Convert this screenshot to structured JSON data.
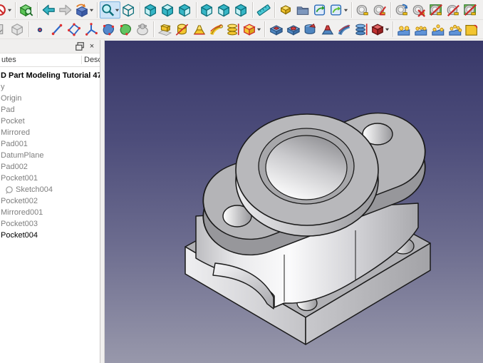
{
  "toolbars": {
    "row1": [
      {
        "icon": "draw-style",
        "name": "draw-style",
        "dropdown": true,
        "cut": true
      },
      {
        "sep": true
      },
      {
        "icon": "fit-all",
        "name": "view-fit-all"
      },
      {
        "sep": true
      },
      {
        "icon": "nav-back",
        "name": "navigate-back"
      },
      {
        "icon": "nav-forward",
        "name": "navigate-forward",
        "disabled": true
      },
      {
        "icon": "linked-object",
        "name": "go-to-linked-object",
        "dropdown": true
      },
      {
        "sep": true
      },
      {
        "icon": "zoom",
        "name": "zoom-tools",
        "active": true,
        "dropdown": true
      },
      {
        "icon": "cube-axo",
        "name": "view-axonometric"
      },
      {
        "sep": true
      },
      {
        "icon": "cube-front",
        "name": "view-front"
      },
      {
        "icon": "cube-top",
        "name": "view-top"
      },
      {
        "icon": "cube-right",
        "name": "view-right"
      },
      {
        "sep": true
      },
      {
        "icon": "cube-rear",
        "name": "view-rear"
      },
      {
        "icon": "cube-bottom",
        "name": "view-bottom"
      },
      {
        "icon": "cube-left",
        "name": "view-left"
      },
      {
        "sep": true
      },
      {
        "icon": "ruler",
        "name": "measure-distance"
      },
      {
        "sep": true
      },
      {
        "icon": "create-part",
        "name": "create-part"
      },
      {
        "icon": "create-group",
        "name": "create-group"
      },
      {
        "icon": "make-link",
        "name": "make-link"
      },
      {
        "icon": "make-sub-link",
        "name": "make-sub-link",
        "dropdown": true
      },
      {
        "sep": true
      },
      {
        "icon": "measure-linear",
        "name": "measure-linear"
      },
      {
        "icon": "measure-angular",
        "name": "measure-angular"
      },
      {
        "sep": true
      },
      {
        "icon": "measure-refresh",
        "name": "measure-refresh"
      },
      {
        "icon": "measure-clear",
        "name": "measure-clear-all"
      },
      {
        "icon": "measure-toggle-3d",
        "name": "toggle-measurement-3d"
      },
      {
        "icon": "measure-toggle-delta",
        "name": "toggle-measurement-delta"
      },
      {
        "icon": "measure-toggle-3d",
        "name": "toggle-measurement-overflow"
      }
    ],
    "row2": [
      {
        "icon": "cut-gray",
        "name": "toolbar-cut-icon",
        "cut": true
      },
      {
        "icon": "create-body",
        "name": "create-body",
        "disabled": true
      },
      {
        "sep": true
      },
      {
        "icon": "datum-point",
        "name": "create-datum-point"
      },
      {
        "icon": "datum-line",
        "name": "create-datum-line"
      },
      {
        "icon": "datum-plane",
        "name": "create-datum-plane"
      },
      {
        "icon": "datum-cs",
        "name": "create-local-coordinate-system"
      },
      {
        "icon": "shape-binder",
        "name": "create-shape-binder"
      },
      {
        "icon": "sub-shape-binder",
        "name": "create-sub-shape-binder"
      },
      {
        "icon": "clone",
        "name": "create-clone"
      },
      {
        "sep": true
      },
      {
        "icon": "pad",
        "name": "pad"
      },
      {
        "icon": "revolution",
        "name": "revolution"
      },
      {
        "icon": "additive-loft",
        "name": "additive-loft"
      },
      {
        "icon": "additive-pipe",
        "name": "additive-pipe"
      },
      {
        "icon": "additive-helix",
        "name": "additive-helix"
      },
      {
        "icon": "additive-primitive",
        "name": "additive-primitive",
        "dropdown": true
      },
      {
        "sep": true
      },
      {
        "icon": "pocket",
        "name": "pocket"
      },
      {
        "icon": "hole",
        "name": "hole"
      },
      {
        "icon": "groove",
        "name": "groove"
      },
      {
        "icon": "subtractive-loft",
        "name": "subtractive-loft"
      },
      {
        "icon": "subtractive-pipe",
        "name": "subtractive-pipe"
      },
      {
        "icon": "subtractive-helix",
        "name": "subtractive-helix"
      },
      {
        "icon": "subtractive-primitive",
        "name": "subtractive-primitive",
        "dropdown": true
      },
      {
        "sep": true
      },
      {
        "icon": "mirrored",
        "name": "mirrored-transform"
      },
      {
        "icon": "linear-pattern",
        "name": "linear-pattern"
      },
      {
        "icon": "polar-pattern",
        "name": "polar-pattern"
      },
      {
        "icon": "multi-transform",
        "name": "multi-transform"
      },
      {
        "icon": "fillet-cut",
        "name": "toolbar-overflow-icon"
      }
    ]
  },
  "side_panel": {
    "dock": {
      "float_label": "float",
      "close_label": "×"
    },
    "columns": [
      {
        "label": "utes"
      },
      {
        "label": "Desc"
      }
    ],
    "tree": [
      {
        "label": "D Part Modeling Tutorial 47",
        "style": "bold"
      },
      {
        "label": "y",
        "style": "normal"
      },
      {
        "label": "Origin",
        "gray": true
      },
      {
        "label": "Pad",
        "gray": true
      },
      {
        "label": "Pocket",
        "gray": true
      },
      {
        "label": "Mirrored",
        "gray": true
      },
      {
        "label": "Pad001",
        "gray": true
      },
      {
        "label": "DatumPlane",
        "gray": true
      },
      {
        "label": "Pad002",
        "gray": true
      },
      {
        "label": "Pocket001",
        "gray": true
      },
      {
        "label": "Sketch004",
        "gray": true,
        "icon": "sketch-icon"
      },
      {
        "label": "Pocket002",
        "gray": true
      },
      {
        "label": "Mirrored001",
        "gray": true
      },
      {
        "label": "Pocket003",
        "gray": true
      },
      {
        "label": "Pocket004",
        "style": "active"
      }
    ]
  },
  "viewport": {
    "background_top": "#383869",
    "background_bottom": "#9898ab",
    "model": "flange-bracket-part",
    "model_color": "#b2b2b5",
    "edge_color": "#1a1a1a"
  }
}
